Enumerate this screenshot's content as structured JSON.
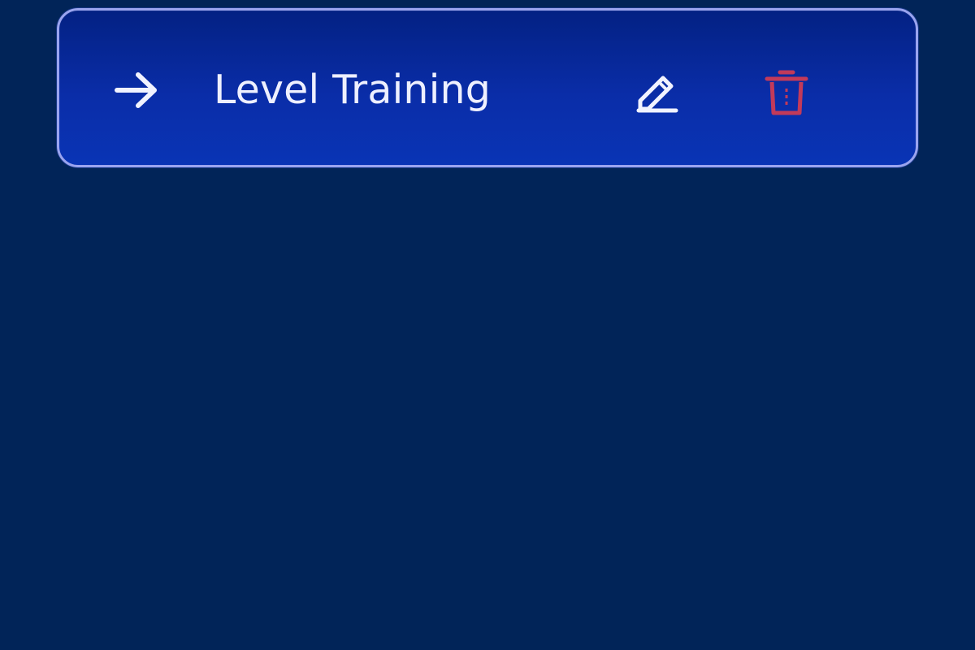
{
  "colors": {
    "page_background": "#012458",
    "card_background": "#0a2da8",
    "card_border": "#9aa4ef",
    "label_text": "#eef0ff",
    "delete_accent": "#c23a5a"
  },
  "list": {
    "items": [
      {
        "label": "Level Training",
        "lead_icon": "arrow-right-icon",
        "edit_icon": "pencil-icon",
        "delete_icon": "trash-icon"
      }
    ]
  }
}
